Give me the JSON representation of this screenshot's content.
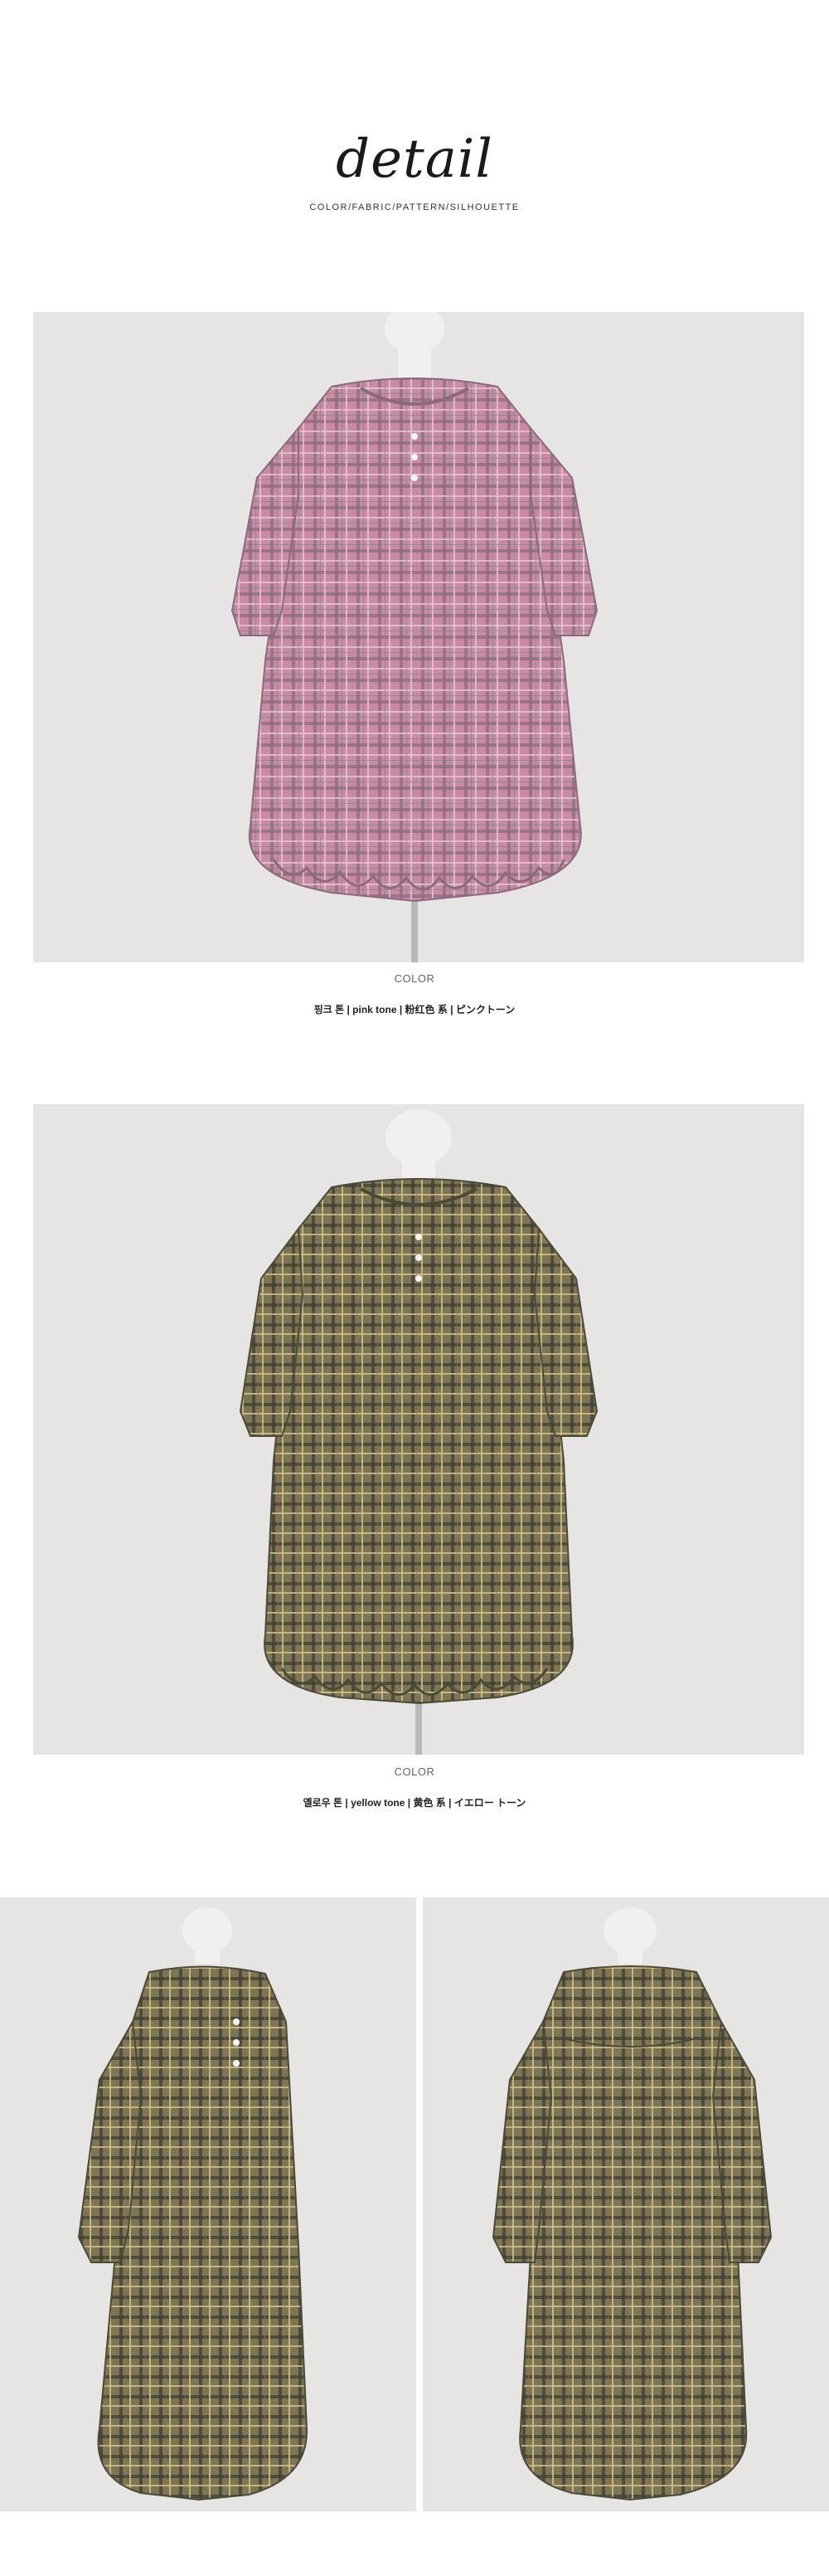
{
  "header": {
    "title": "detail",
    "subtitle": "COLOR/FABRIC/PATTERN/SILHOUETTE"
  },
  "sections": [
    {
      "color_label": "COLOR",
      "color_name": "핑크 톤 | pink tone | 粉红色 系 | ピンクトーン"
    },
    {
      "color_label": "COLOR",
      "color_name": "옐로우 톤 | yellow  tone | 黄色  系 | イエロー トーン"
    }
  ],
  "colors": {
    "pink_dress": "#c98aa6",
    "pink_dress_line": "#8a6a7c",
    "yellow_dress": "#7d7553",
    "yellow_dress_line": "#4a4a38",
    "background": "#e6e5e3",
    "mannequin": "#f1f0ee"
  },
  "icons": {
    "pink_photo": "pink-plaid-dress-front",
    "yellow_photo": "yellow-plaid-dress-front",
    "yellow_side": "yellow-plaid-dress-side",
    "yellow_back": "yellow-plaid-dress-back"
  }
}
